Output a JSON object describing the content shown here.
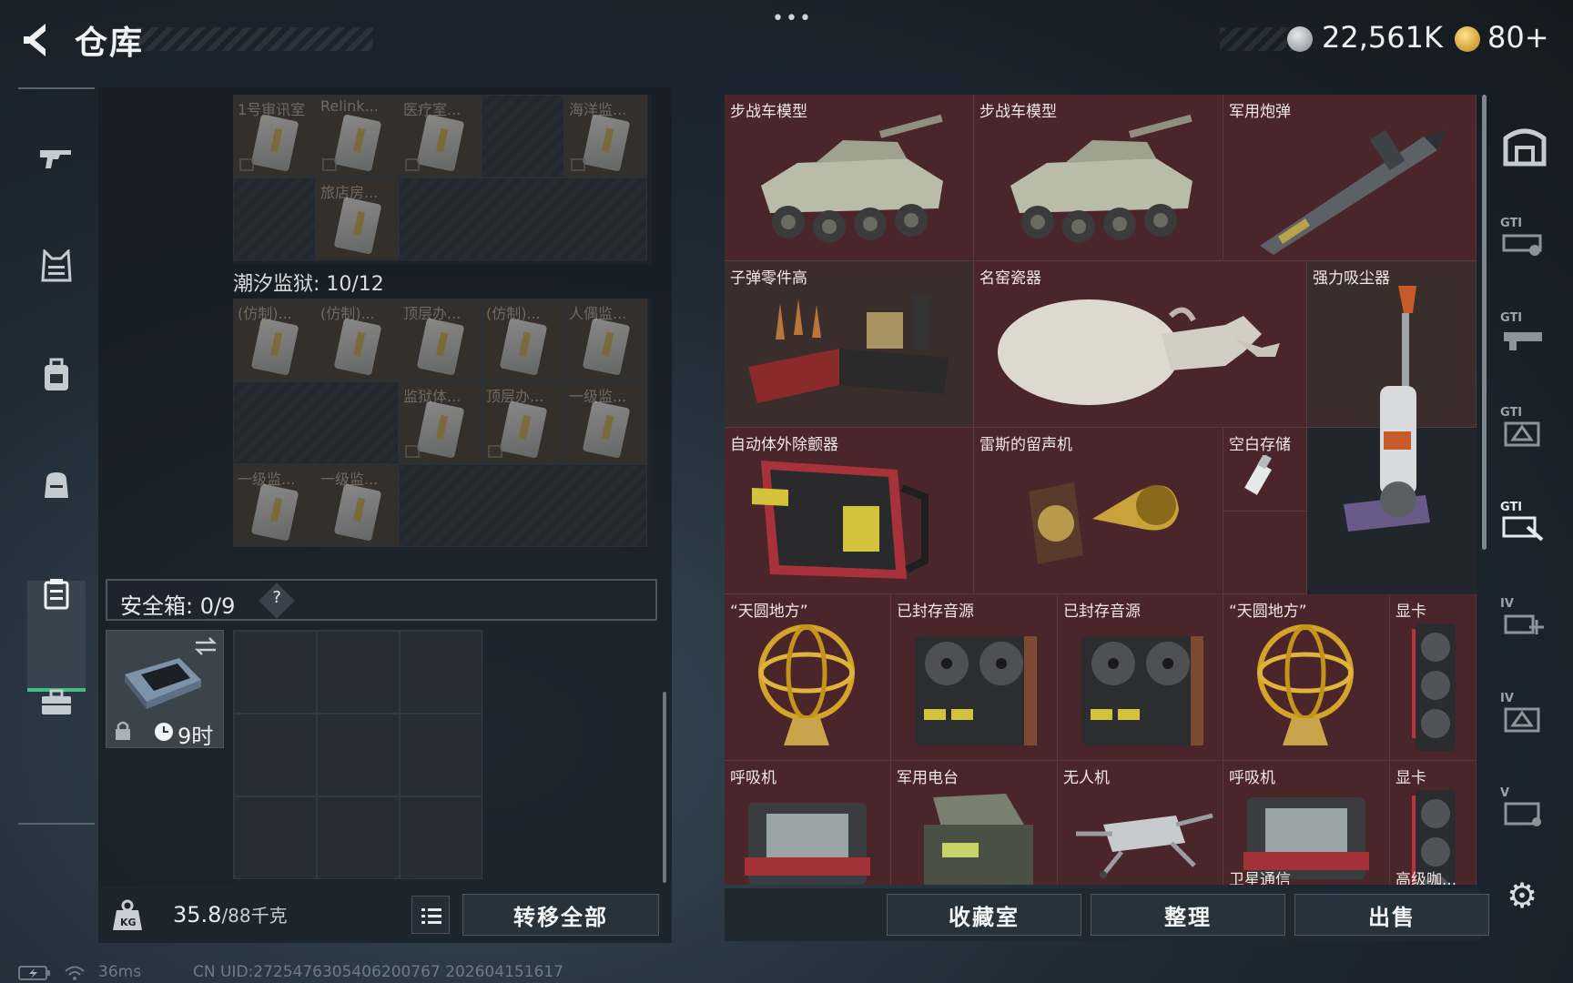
{
  "header": {
    "title": "仓库",
    "menu_dots": "•••",
    "currency_silver": "22,561K",
    "currency_gold": "80+"
  },
  "left_nav": {
    "items": [
      "rifle-icon",
      "vest-icon",
      "backpack-icon",
      "bag-icon",
      "safe-box-icon",
      "briefcase-icon"
    ],
    "active": "safe-box-icon"
  },
  "stash": {
    "top_grid_labels": [
      "1号审讯室",
      "Relink...",
      "医疗室...",
      "",
      "海洋监..."
    ],
    "top_grid_labels_row2": [
      "",
      "旅店房..."
    ],
    "section_title": "潮汐监狱: 10/12",
    "grid_row1": [
      "(仿制)...",
      "(仿制)...",
      "顶层办...",
      "(仿制)...",
      "人偶监..."
    ],
    "grid_row2": [
      "",
      "",
      "监狱体...",
      "顶层办...",
      "一级监..."
    ],
    "grid_row3": [
      "一级监...",
      "一级监..."
    ]
  },
  "safe_box": {
    "label": "安全箱: 0/9",
    "help": "?",
    "timer": "9时"
  },
  "bottom_left": {
    "weight": "35.8",
    "weight_cap": "/88千克",
    "transfer_all": "转移全部"
  },
  "items": {
    "r1": [
      "步战车模型",
      "步战车模型",
      "军用炮弹"
    ],
    "r2": [
      "子弹零件高",
      "名窑瓷器",
      "强力吸尘器"
    ],
    "r3": [
      "自动体外除颤器",
      "雷斯的留声机",
      "空白存储"
    ],
    "r4a": [
      "“天圆地方”",
      "显卡"
    ],
    "r5": [
      "“天圆地方”",
      "已封存音源",
      "已封存音源"
    ],
    "r5b": [
      "呼吸机",
      "显卡"
    ],
    "r6": [
      "呼吸机",
      "军用电台",
      "无人机"
    ],
    "r6b": [
      "卫星通信",
      "高级咖..."
    ]
  },
  "right_nav": {
    "labels": [
      "",
      "GTI",
      "GTI",
      "GTI",
      "GTI",
      "IV",
      "IV",
      "V"
    ],
    "active_index": 4
  },
  "buttons": {
    "collection": "收藏室",
    "organize": "整理",
    "sell": "出售"
  },
  "status_bar": {
    "ping": "36ms",
    "uid": "CN UID:2725476305406200767 202604151617"
  }
}
